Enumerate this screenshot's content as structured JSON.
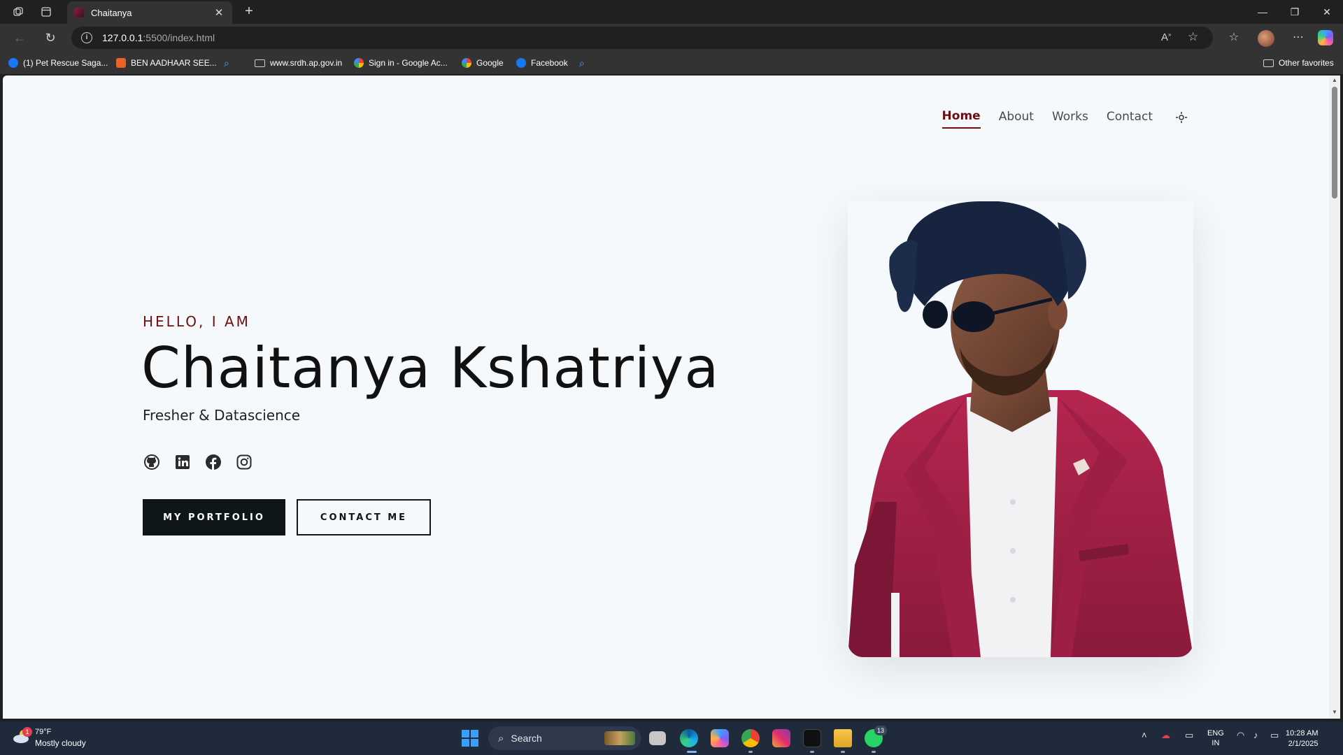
{
  "browser": {
    "tab_title": "Chaitanya",
    "url_host": "127.0.0.1",
    "url_path": ":5500/index.html",
    "bookmarks": [
      {
        "label": "(1) Pet Rescue Saga...",
        "icon": "facebook-icon",
        "color": "#1877f2"
      },
      {
        "label": "BEN AADHAAR SEE...",
        "icon": "orange-site-icon",
        "color": "#e8622a"
      },
      {
        "label": "",
        "icon": "search-icon",
        "color": "#4aa3ff"
      },
      {
        "label": "www.srdh.ap.gov.in",
        "icon": "folder-icon",
        "color": "#d0d0d0"
      },
      {
        "label": "Sign in - Google Ac...",
        "icon": "google-icon",
        "color": "#ffffff"
      },
      {
        "label": "Google",
        "icon": "google-icon",
        "color": "#ffffff"
      },
      {
        "label": "Facebook",
        "icon": "facebook-icon",
        "color": "#1877f2"
      },
      {
        "label": "",
        "icon": "search-icon",
        "color": "#4aa3ff"
      }
    ],
    "other_favorites": "Other favorites"
  },
  "site": {
    "nav": [
      {
        "label": "Home",
        "active": true
      },
      {
        "label": "About",
        "active": false
      },
      {
        "label": "Works",
        "active": false
      },
      {
        "label": "Contact",
        "active": false
      }
    ],
    "greeting": "HELLO, I AM",
    "name": "Chaitanya Kshatriya",
    "role": "Fresher & Datascience",
    "socials": [
      "github-icon",
      "linkedin-icon",
      "facebook-icon",
      "instagram-icon"
    ],
    "primary_button": "MY PORTFOLIO",
    "secondary_button": "CONTACT ME",
    "accent_color": "#6b0f13",
    "dark_color": "#0f1619"
  },
  "taskbar": {
    "weather_badge": "1",
    "temperature": "79°F",
    "weather": "Mostly cloudy",
    "search_placeholder": "Search",
    "lang_top": "ENG",
    "lang_bottom": "IN",
    "time": "10:28 AM",
    "date": "2/1/2025",
    "whatsapp_badge": "13"
  }
}
